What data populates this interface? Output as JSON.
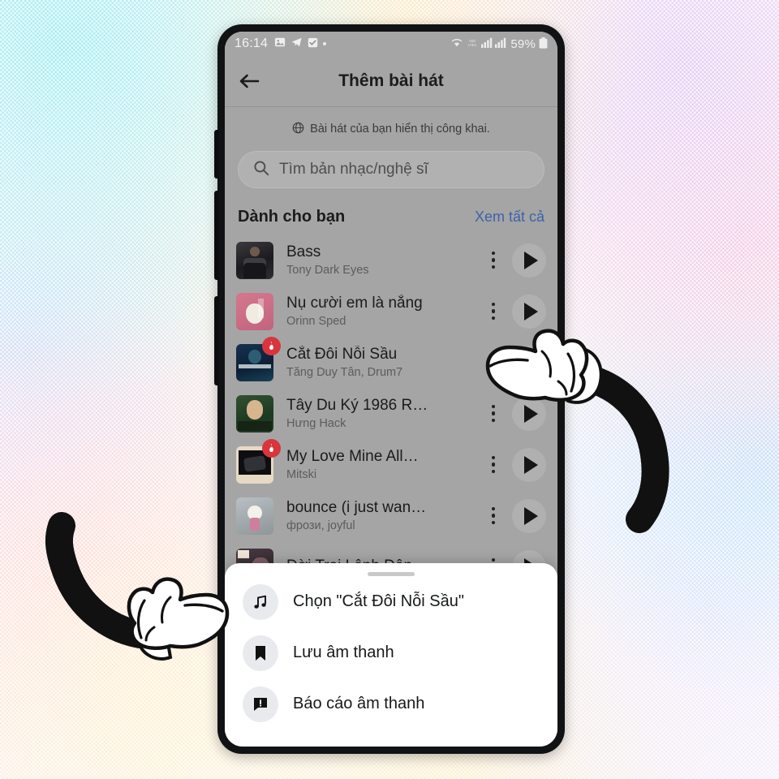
{
  "statusbar": {
    "time": "16:14",
    "left_icons": [
      "photo-icon",
      "telegram-icon",
      "checkbox-icon",
      "dot-icon"
    ],
    "right_icons": [
      "wifi-icon",
      "volte-icon",
      "signal-1-icon",
      "signal-2-icon"
    ],
    "battery_percent": "59%",
    "battery_icon": "battery-icon"
  },
  "appbar": {
    "back_icon": "back-arrow-icon",
    "title": "Thêm bài hát"
  },
  "public_note": {
    "icon": "globe-icon",
    "text": "Bài hát của bạn hiển thị công khai."
  },
  "search": {
    "icon": "search-icon",
    "placeholder": "Tìm bản nhạc/nghệ sĩ",
    "value": ""
  },
  "section": {
    "heading": "Dành cho bạn",
    "see_all": "Xem tất cả",
    "see_all_color": "#3c63a8"
  },
  "songs": [
    {
      "title": "Bass",
      "artist": "Tony Dark Eyes",
      "art": "art-bass",
      "badge": false,
      "menu_icon": "kebab-menu-icon",
      "play_icon": "play-icon"
    },
    {
      "title": "Nụ cười em là nắng",
      "artist": "Orinn Sped",
      "art": "art-dog",
      "badge": false,
      "menu_icon": "kebab-menu-icon",
      "play_icon": "play-icon"
    },
    {
      "title": "Cắt Đôi Nỗi Sầu",
      "artist": "Tăng Duy Tân, Drum7",
      "art": "art-cat",
      "badge": true,
      "menu_icon": "kebab-menu-icon",
      "play_icon": "play-icon"
    },
    {
      "title": "Tây Du Ký 1986 R…",
      "artist": "Hưng Hack",
      "art": "art-tay",
      "badge": false,
      "menu_icon": "kebab-menu-icon",
      "play_icon": "play-icon"
    },
    {
      "title": "My Love Mine All…",
      "artist": "Mitski",
      "art": "art-love",
      "badge": true,
      "menu_icon": "kebab-menu-icon",
      "play_icon": "play-icon"
    },
    {
      "title": "bounce (i just wan…",
      "artist": "фрози, joyful",
      "art": "art-bounce",
      "badge": false,
      "menu_icon": "kebab-menu-icon",
      "play_icon": "play-icon"
    },
    {
      "title": "Đời Trai Lênh Đên…",
      "artist": "",
      "art": "art-doi",
      "badge": false,
      "menu_icon": "kebab-menu-icon",
      "play_icon": "play-icon"
    }
  ],
  "badge_icon": "flame-badge-icon",
  "badge_color": "#d8353e",
  "sheet": {
    "grabber": "drag-handle",
    "items": [
      {
        "label": "Chọn \"Cắt Đôi Nỗi Sầu\"",
        "icon": "music-note-icon"
      },
      {
        "label": "Lưu âm thanh",
        "icon": "bookmark-icon"
      },
      {
        "label": "Báo cáo âm thanh",
        "icon": "report-flag-icon"
      }
    ]
  },
  "cursors": [
    {
      "name": "pointing-hand-right-arm",
      "target": "kebab-menu-for-cat-doi-noi-sau"
    },
    {
      "name": "pointing-hand-left-arm",
      "target": "sheet-item-chon-cat-doi-noi-sau"
    }
  ]
}
